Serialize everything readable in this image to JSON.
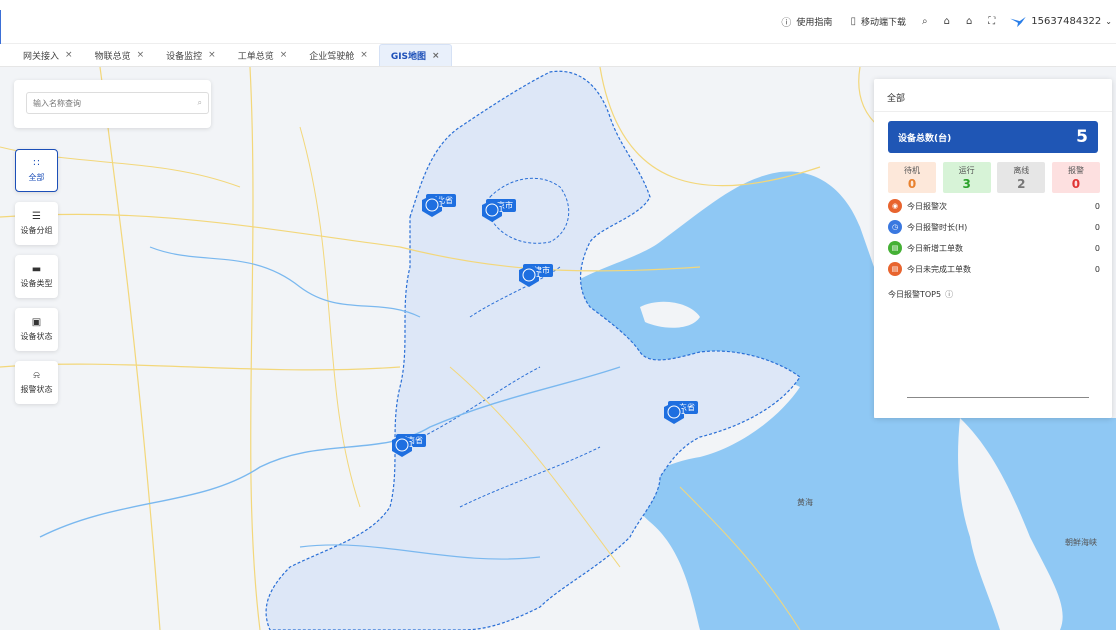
{
  "topbar": {
    "guide_label": "使用指南",
    "mobile_label": "移动端下载",
    "username": "15637484322"
  },
  "tabs": [
    {
      "label": "网关接入"
    },
    {
      "label": "物联总览"
    },
    {
      "label": "设备监控"
    },
    {
      "label": "工单总览"
    },
    {
      "label": "企业驾驶舱"
    },
    {
      "label": "GIS地图",
      "active": true
    }
  ],
  "search": {
    "placeholder": "输入名称查询"
  },
  "side_buttons": [
    {
      "label": "全部",
      "icon": "grid-icon",
      "active": true
    },
    {
      "label": "设备分组",
      "icon": "layers-icon"
    },
    {
      "label": "设备类型",
      "icon": "box-icon"
    },
    {
      "label": "设备状态",
      "icon": "chart-icon"
    },
    {
      "label": "报警状态",
      "icon": "bell-icon"
    }
  ],
  "markers": [
    {
      "count": "1",
      "label": "河北省"
    },
    {
      "count": "1",
      "label": "北京市"
    },
    {
      "count": "1",
      "label": "天津市"
    },
    {
      "count": "1",
      "label": "山东省"
    },
    {
      "count": "1",
      "label": "河南省"
    }
  ],
  "map_labels": {
    "yellow_sea": "黄海",
    "korea_bay": "朝鲜海峡"
  },
  "panel": {
    "title": "全部",
    "total_label": "设备总数(台)",
    "total_value": "5",
    "status": [
      {
        "label": "待机",
        "value": "0"
      },
      {
        "label": "运行",
        "value": "3"
      },
      {
        "label": "离线",
        "value": "2"
      },
      {
        "label": "报警",
        "value": "0"
      }
    ],
    "stats": [
      {
        "label": "今日报警次",
        "value": "0",
        "color": "#e8642e",
        "icon": "alarm-icon"
      },
      {
        "label": "今日报警时长(H)",
        "value": "0",
        "color": "#3a78e0",
        "icon": "clock-icon"
      },
      {
        "label": "今日新增工单数",
        "value": "0",
        "color": "#45b035",
        "icon": "add-order-icon"
      },
      {
        "label": "今日未完成工单数",
        "value": "0",
        "color": "#e8642e",
        "icon": "pending-order-icon"
      }
    ],
    "top5_title": "今日报警TOP5"
  },
  "colors": {
    "accent": "#1c4fb8",
    "marker": "#1e6fe0",
    "sea": "#8fc8f4",
    "region": "#dde7f7"
  }
}
